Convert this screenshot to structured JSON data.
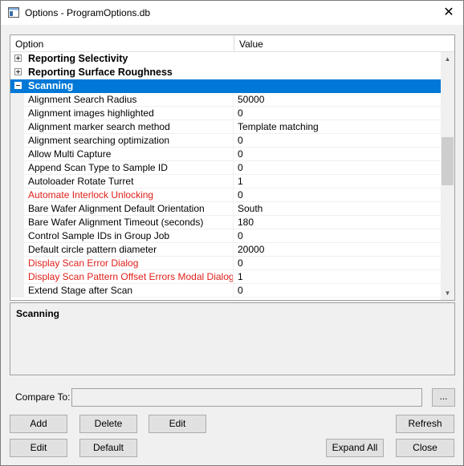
{
  "window": {
    "title": "Options - ProgramOptions.db",
    "close_glyph": "✕"
  },
  "grid": {
    "header": {
      "option": "Option",
      "value": "Value"
    },
    "categories_collapsed": [
      {
        "label": "Reporting Selectivity"
      },
      {
        "label": "Reporting Surface Roughness"
      }
    ],
    "selected_category": {
      "label": "Scanning"
    },
    "rows": [
      {
        "name": "Alignment Search Radius",
        "value": "50000",
        "red": false
      },
      {
        "name": "Alignment images highlighted",
        "value": "0",
        "red": false
      },
      {
        "name": "Alignment marker search method",
        "value": "Template matching",
        "red": false
      },
      {
        "name": "Alignment searching optimization",
        "value": "0",
        "red": false
      },
      {
        "name": "Allow Multi Capture",
        "value": "0",
        "red": false
      },
      {
        "name": "Append Scan Type to Sample ID",
        "value": "0",
        "red": false
      },
      {
        "name": "Autoloader Rotate Turret",
        "value": "1",
        "red": false
      },
      {
        "name": "Automate Interlock Unlocking",
        "value": "0",
        "red": true
      },
      {
        "name": "Bare Wafer Alignment Default Orientation",
        "value": "South",
        "red": false
      },
      {
        "name": "Bare Wafer Alignment Timeout (seconds)",
        "value": "180",
        "red": false
      },
      {
        "name": "Control Sample IDs in Group Job",
        "value": "0",
        "red": false
      },
      {
        "name": "Default circle pattern diameter",
        "value": "20000",
        "red": false
      },
      {
        "name": "Display Scan Error Dialog",
        "value": "0",
        "red": true
      },
      {
        "name": "Display Scan Pattern Offset Errors Modal Dialog",
        "value": "1",
        "red": true
      },
      {
        "name": "Extend Stage after Scan",
        "value": "0",
        "red": false
      }
    ]
  },
  "description": {
    "title": "Scanning"
  },
  "compare": {
    "label": "Compare To:",
    "value": "",
    "browse_label": "..."
  },
  "buttons": {
    "add": "Add",
    "delete": "Delete",
    "edit_top": "Edit",
    "refresh": "Refresh",
    "edit_bottom": "Edit",
    "default": "Default",
    "expand_all": "Expand All",
    "close": "Close"
  },
  "colors": {
    "selection": "#0078d7",
    "red_text": "#e0201a"
  }
}
